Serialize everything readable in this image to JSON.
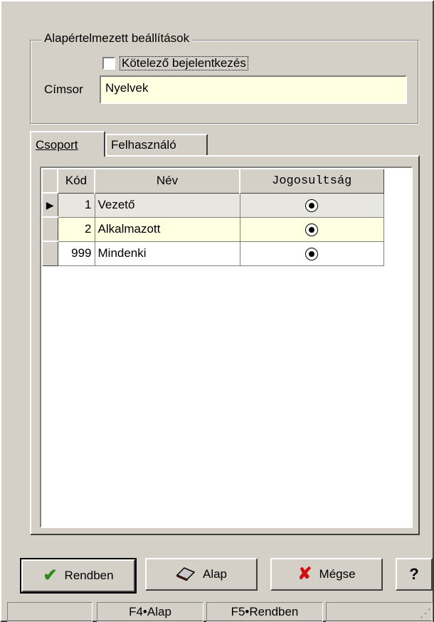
{
  "dialog": {
    "group_title": "Alapértelmezett beállítások",
    "checkbox_label": "Kötelező bejelentkezés",
    "checkbox_checked": false,
    "title_label": "Címsor",
    "title_value": "Nyelvek"
  },
  "tabs": [
    {
      "label": "Csoport",
      "active": true
    },
    {
      "label": "Felhasználó",
      "active": false
    }
  ],
  "grid": {
    "columns": [
      "Kód",
      "Név",
      "Jogosultság"
    ],
    "rows": [
      {
        "kod": "1",
        "nev": "Vezető",
        "jog": true
      },
      {
        "kod": "2",
        "nev": "Alkalmazott",
        "jog": true
      },
      {
        "kod": "999",
        "nev": "Mindenki",
        "jog": true
      }
    ]
  },
  "buttons": {
    "ok": "Rendben",
    "reset": "Alap",
    "cancel": "Mégse",
    "help": "?"
  },
  "status": {
    "f4": "F4•Alap",
    "f5": "F5•Rendben"
  },
  "colors": {
    "face": "#d4d0c8",
    "input_bg": "#ffffe1",
    "ok_check": "#2a8a1a",
    "cancel_x": "#d01010"
  }
}
